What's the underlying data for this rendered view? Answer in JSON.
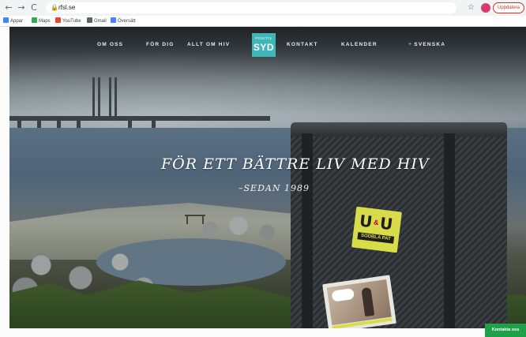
{
  "browser": {
    "nav": {
      "back": "←",
      "forward": "→",
      "reload": "C"
    },
    "address": {
      "url": "rfsl.se",
      "lock": "🔒"
    },
    "star": "☆",
    "profile_initial": "",
    "update_label": "Uppdatera",
    "bookmarks": [
      {
        "label": "Appar",
        "color": "#4285f4"
      },
      {
        "label": "Maps",
        "color": "#34a853"
      },
      {
        "label": "YouTube",
        "color": "#ea4335"
      },
      {
        "label": "Gmail",
        "color": "#5f6368"
      },
      {
        "label": "Översätt",
        "color": "#4285f4"
      }
    ]
  },
  "site": {
    "nav": {
      "items_left": [
        "OM OSS",
        "FÖR DIG",
        "ALLT OM HIV"
      ],
      "items_right": [
        "KONTAKT",
        "KALENDER"
      ],
      "language": "SVENSKA"
    },
    "logo": {
      "small": "POSITIV",
      "big": "SYD"
    },
    "hero": {
      "headline": "FÖR ETT BÄTTRE LIV MED HIV",
      "subline": "–SEDAN 1989"
    },
    "stickers": {
      "uu_left": "U",
      "uu_amp": "&",
      "uu_right": "U",
      "uu_tag": "SODBLA PAT"
    },
    "contact_label": "Kontakta oss"
  },
  "colors": {
    "logo_teal": "#3fb6b8",
    "contact_green": "#1fa14a",
    "update_red": "#d93025"
  }
}
